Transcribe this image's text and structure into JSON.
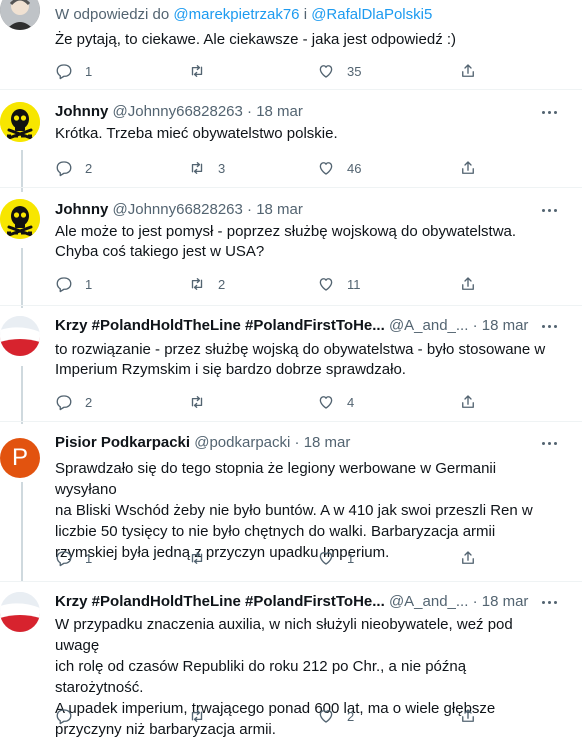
{
  "tweets": [
    {
      "replying_prefix": "W odpowiedzi do",
      "mention1": "@marekpietrzak76",
      "joiner": "i",
      "mention2": "@RafalDlaPolski5",
      "text": "Że pytają, to ciekawe. Ale ciekawsze - jaka jest odpowiedź :)",
      "replies": "1",
      "retweets": "",
      "likes": "35"
    },
    {
      "name": "Johnny",
      "handle": "@Johnny66828263",
      "sep": "·",
      "date": "18 mar",
      "text": "Krótka. Trzeba mieć obywatelstwo polskie.",
      "replies": "2",
      "retweets": "3",
      "likes": "46"
    },
    {
      "name": "Johnny",
      "handle": "@Johnny66828263",
      "sep": "·",
      "date": "18 mar",
      "lines": [
        "Ale może to jest pomysł - poprzez służbę wojskową do obywatelstwa.",
        "Chyba coś takiego jest w USA?"
      ],
      "replies": "1",
      "retweets": "2",
      "likes": "11"
    },
    {
      "name": "Krzy #PolandHoldTheLine #PolandFirstToHe...",
      "handle": "@A_and_...",
      "sep": "·",
      "date": "18 mar",
      "lines": [
        "to rozwiązanie - przez służbę wojską do obywatelstwa - było stosowane w",
        "Imperium Rzymskim i się bardzo dobrze sprawdzało."
      ],
      "replies": "2",
      "retweets": "",
      "likes": "4"
    },
    {
      "name": "Pisior Podkarpacki",
      "handle": "@podkarpacki",
      "sep": "·",
      "date": "18 mar",
      "avatar_letter": "P",
      "lines": [
        "Sprawdzało się do tego stopnia że legiony werbowane w Germanii wysyłano",
        "na Bliski Wschód żeby nie było buntów. A w 410 jak swoi przeszli Ren w",
        "liczbie 50 tysięcy to nie było chętnych do walki. Barbaryzacja armii",
        "rzymskiej była jedną z przyczyn upadku Imperium."
      ],
      "replies": "1",
      "retweets": "",
      "likes": "1"
    },
    {
      "name": "Krzy #PolandHoldTheLine #PolandFirstToHe...",
      "handle": "@A_and_...",
      "sep": "·",
      "date": "18 mar",
      "lines": [
        "W przypadku znaczenia auxilia, w nich służyli nieobywatele, weź pod uwagę",
        "ich rolę od czasów Republiki do roku 212 po Chr., a nie późną starożytność.",
        "A upadek imperium, trwającego ponad 600 lat, ma o wiele głębsze",
        "przyczyny niż barbaryzacja armii."
      ],
      "replies": "",
      "retweets": "",
      "likes": "2"
    }
  ],
  "icons": {
    "reply": "reply-icon",
    "retweet": "retweet-icon",
    "like": "heart-icon",
    "share": "share-icon",
    "more": "more-icon",
    "avatar_symbol": "skull-crossbones-icon"
  },
  "colors": {
    "link": "#1d9bf0",
    "muted": "#536471",
    "thread_line": "#cfd9de",
    "johnny_avatar": "#f7e600",
    "pisior_avatar": "#e2530f"
  }
}
